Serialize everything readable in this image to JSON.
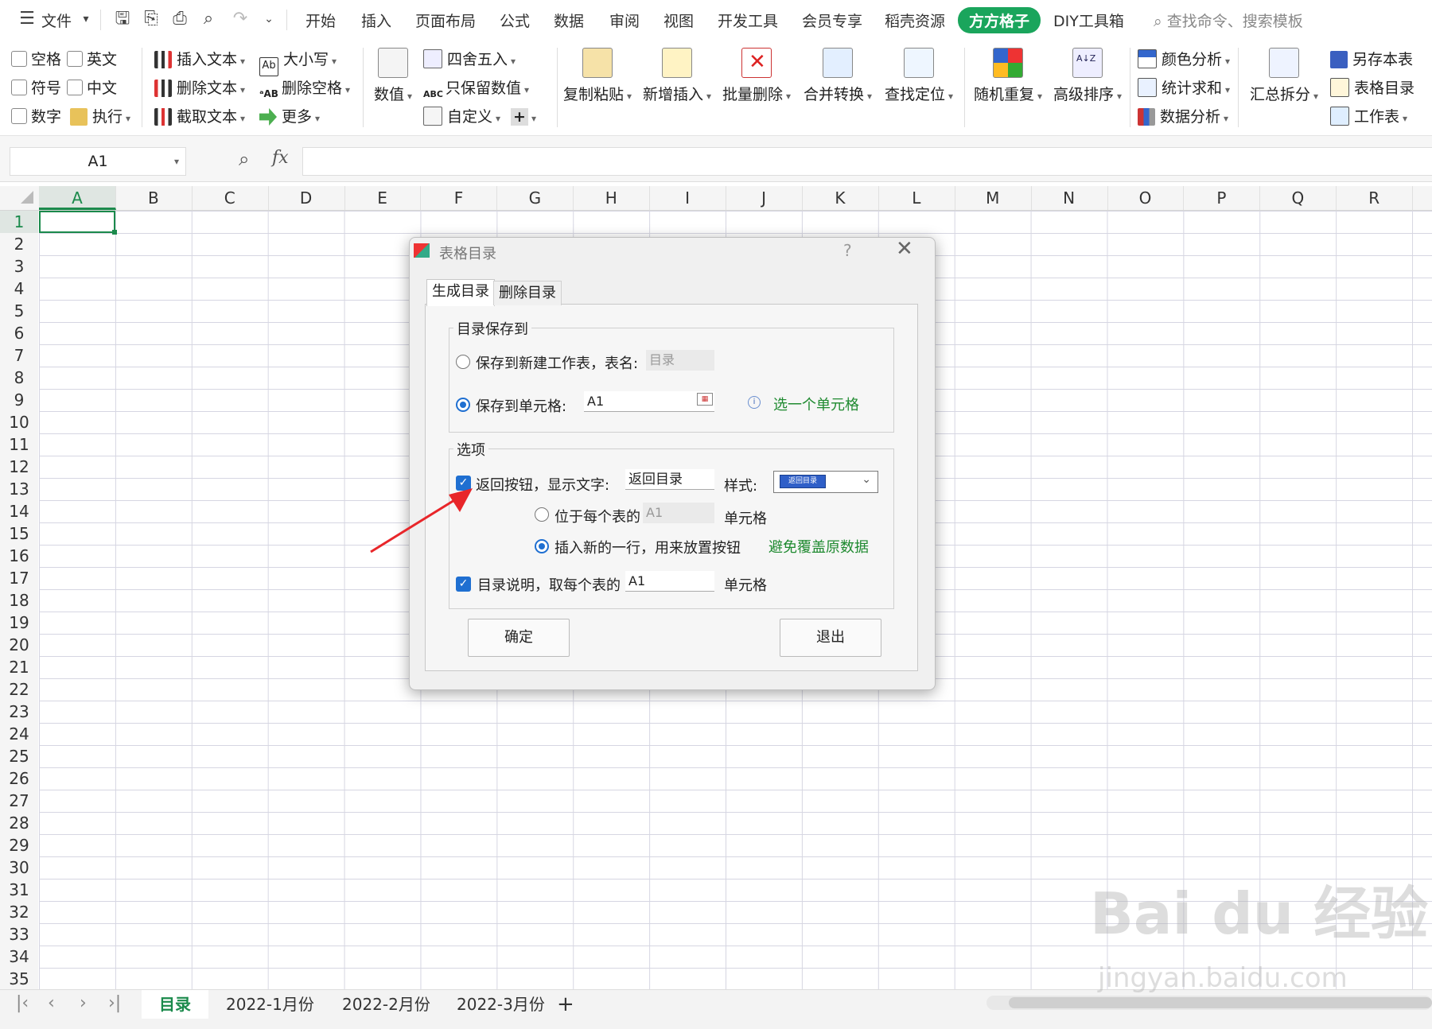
{
  "menu": {
    "file": "文件",
    "tabs": [
      "开始",
      "插入",
      "页面布局",
      "公式",
      "数据",
      "审阅",
      "视图",
      "开发工具",
      "会员专享",
      "稻壳资源",
      "方方格子",
      "DIY工具箱"
    ],
    "active_tab": "方方格子",
    "search_placeholder": "查找命令、搜索模板"
  },
  "ribbon": {
    "checks": [
      "空格",
      "英文",
      "符号",
      "中文",
      "数字"
    ],
    "execute": "执行",
    "text_tools": [
      "插入文本",
      "删除文本",
      "截取文本"
    ],
    "case_tools": [
      "大小写",
      "删除空格",
      "更多"
    ],
    "numeric": "数值",
    "round_tools": [
      "四舍五入",
      "只保留数值",
      "自定义"
    ],
    "big_buttons": [
      "复制粘贴",
      "新增插入",
      "批量删除",
      "合并转换",
      "查找定位",
      "随机重复",
      "高级排序"
    ],
    "analysis": [
      "颜色分析",
      "统计求和",
      "数据分析"
    ],
    "summary": "汇总拆分",
    "right_tools": [
      "另存本表",
      "表格目录",
      "工作表"
    ]
  },
  "formula_bar": {
    "name_box": "A1",
    "fx": "fx"
  },
  "grid": {
    "columns": [
      "A",
      "B",
      "C",
      "D",
      "E",
      "F",
      "G",
      "H",
      "I",
      "J",
      "K",
      "L",
      "M",
      "N",
      "O",
      "P",
      "Q",
      "R"
    ],
    "rows": [
      "1",
      "2",
      "3",
      "4",
      "5",
      "6",
      "7",
      "8",
      "9",
      "10",
      "11",
      "12",
      "13",
      "14",
      "15",
      "16",
      "17",
      "18",
      "19",
      "20",
      "21",
      "22",
      "23",
      "24",
      "25",
      "26",
      "27",
      "28",
      "29",
      "30",
      "31",
      "32",
      "33",
      "34",
      "35"
    ],
    "selected_col": "A",
    "selected_row": "1"
  },
  "sheets": {
    "tabs": [
      "目录",
      "2022-1月份",
      "2022-2月份",
      "2022-3月份"
    ],
    "active": "目录",
    "add": "+"
  },
  "dialog": {
    "title": "表格目录",
    "help": "?",
    "close": "✕",
    "tabs": [
      "生成目录",
      "删除目录"
    ],
    "save_group": "目录保存到",
    "save_new_sheet": "保存到新建工作表，表名:",
    "new_sheet_name": "目录",
    "save_to_cell": "保存到单元格:",
    "cell_value": "A1",
    "pick_hint": "选一个单元格",
    "options_group": "选项",
    "back_button_label": "返回按钮，显示文字:",
    "back_button_text": "返回目录",
    "style_label": "样式:",
    "style_preview": "返回目录",
    "pos_each_sheet": "位于每个表的",
    "pos_cell": "A1",
    "cell_suffix": "单元格",
    "insert_row": "插入新的一行，用来放置按钮",
    "avoid_hint": "避免覆盖原数据",
    "desc_label": "目录说明，取每个表的",
    "desc_cell": "A1",
    "desc_suffix": "单元格",
    "ok": "确定",
    "exit": "退出"
  },
  "watermark": {
    "main": "Bai du 经验",
    "sub": "jingyan.baidu.com"
  }
}
